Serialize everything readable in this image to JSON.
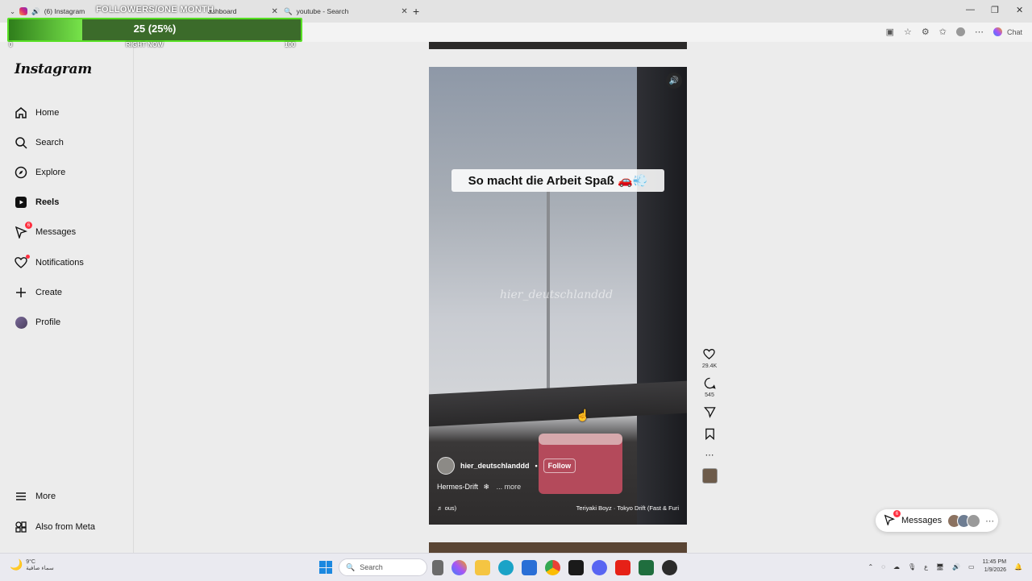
{
  "browser": {
    "tabs": [
      {
        "title": "(6) Instagram"
      },
      {
        "title": "ashboard"
      },
      {
        "title": "youtube - Search"
      }
    ],
    "new_tab": "+",
    "window_controls": [
      "—",
      "❐",
      "✕"
    ],
    "chat_label": "Chat"
  },
  "overlay": {
    "title": "FOLLOWERS/ONE MONTH",
    "value_text": "25 (25%)",
    "progress": 0.25,
    "min": "0",
    "mid": "RIGHT NOW",
    "max": "100"
  },
  "instagram": {
    "logo": "Instagram",
    "nav": [
      {
        "label": "Home"
      },
      {
        "label": "Search"
      },
      {
        "label": "Explore"
      },
      {
        "label": "Reels"
      },
      {
        "label": "Messages",
        "badge": "6"
      },
      {
        "label": "Notifications"
      },
      {
        "label": "Create"
      },
      {
        "label": "Profile"
      }
    ],
    "bottom_nav": [
      {
        "label": "More"
      },
      {
        "label": "Also from Meta"
      }
    ]
  },
  "reel": {
    "caption": "So macht die Arbeit Spaß 🚗💨",
    "watermark": "hier_deutschlanddd",
    "author": "hier_deutschlanddd",
    "follow": "Follow",
    "description": "Hermes-Drift",
    "more": "... more",
    "audio_left": "ous)",
    "audio_track": "Teriyaki Boyz · Tokyo Drift (Fast & Furi",
    "likes": "29.4K",
    "comments": "545"
  },
  "messages_pill": {
    "label": "Messages",
    "badge": "6"
  },
  "taskbar": {
    "temperature": "9°C",
    "weather_text": "سماء صافية",
    "search_placeholder": "Search",
    "lang": "ع",
    "time": "11:45 PM",
    "date": "1/9/2026"
  }
}
